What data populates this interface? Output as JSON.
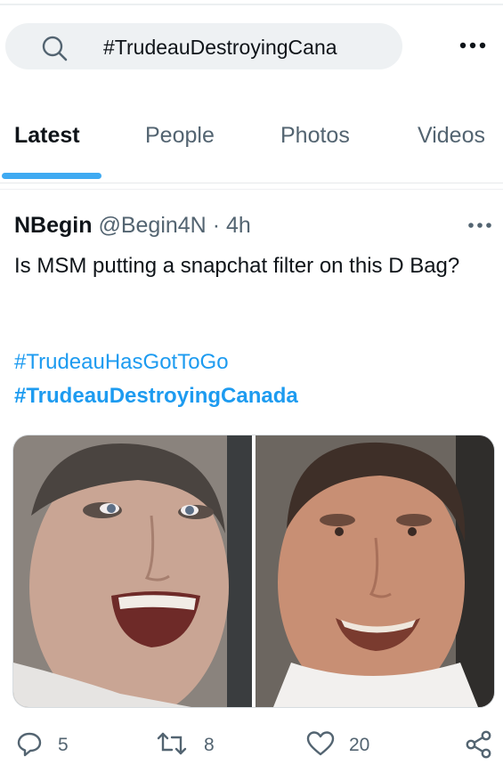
{
  "search": {
    "query": "#TrudeauDestroyingCana"
  },
  "tabs": [
    {
      "label": "Latest"
    },
    {
      "label": "People"
    },
    {
      "label": "Photos"
    },
    {
      "label": "Videos"
    }
  ],
  "tweet": {
    "author_name": "NBegin",
    "handle": "@Begin4N",
    "separator": "·",
    "time": "4h",
    "text": "Is MSM putting a snapchat filter on this D Bag?",
    "hashtags": [
      "#TrudeauHasGotToGo",
      "#TrudeauDestroyingCanada"
    ],
    "stats": {
      "replies": "5",
      "retweets": "8",
      "likes": "20"
    }
  },
  "colors": {
    "accent": "#1d9bf0",
    "muted": "#536471",
    "search_bg": "#eef1f3"
  },
  "icons": [
    "search-icon",
    "more-icon",
    "reply-icon",
    "retweet-icon",
    "like-icon",
    "share-icon"
  ]
}
